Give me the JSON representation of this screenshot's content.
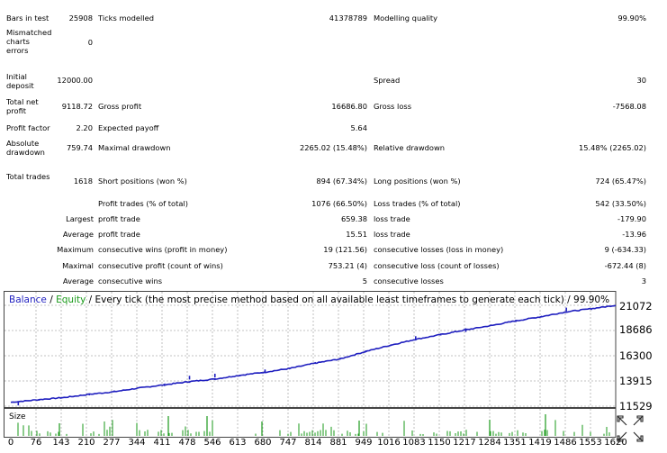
{
  "rows": [
    {
      "top": 15,
      "label": "Bars in test",
      "v1": "25908",
      "lab1": "Ticks modelled",
      "v2": "41378789",
      "lab2": "Modelling quality",
      "v3": "99.90%"
    },
    {
      "top": 31,
      "label": "Mismatched charts errors",
      "v1": "0",
      "v1top": 42
    },
    {
      "top": 80,
      "label": "Initial deposit",
      "v1": "12000.00",
      "v1top": 84,
      "lab2": "Spread",
      "v3": "30"
    },
    {
      "top": 108,
      "label": "Total net profit",
      "v1": "9118.72",
      "lab1": "Gross profit",
      "v2": "16686.80",
      "lab2": "Gross loss",
      "v3": "-7568.08",
      "vtop": 113
    },
    {
      "top": 137,
      "label": "Profit factor",
      "v1": "2.20",
      "lab1": "Expected payoff",
      "v2": "5.64"
    },
    {
      "top": 154,
      "label": "Absolute drawdown",
      "v1": "759.74",
      "lab1": "Maximal drawdown",
      "v2": "2265.02 (15.48%)",
      "lab2": "Relative drawdown",
      "v3": "15.48% (2265.02)",
      "vtop": 159
    },
    {
      "top": 191,
      "label": "Total trades",
      "v1": "1618",
      "lab1": "Short positions (won %)",
      "v2": "894 (67.34%)",
      "lab2": "Long positions (won %)",
      "v3": "724 (65.47%)",
      "vtop": 196
    },
    {
      "top": 221,
      "lab1": "Profit trades (% of total)",
      "v2": "1076 (66.50%)",
      "lab2": "Loss trades (% of total)",
      "v3": "542 (33.50%)"
    },
    {
      "top": 238,
      "ind": "Largest",
      "lab1": "profit trade",
      "v2": "659.38",
      "lab2": "loss trade",
      "v3": "-179.90"
    },
    {
      "top": 255,
      "ind": "Average",
      "lab1": "profit trade",
      "v2": "15.51",
      "lab2": "loss trade",
      "v3": "-13.96"
    },
    {
      "top": 272,
      "ind": "Maximum",
      "lab1": "consecutive wins (profit in money)",
      "v2": "19 (121.56)",
      "lab2": "consecutive losses (loss in money)",
      "v3": "9 (-634.33)"
    },
    {
      "top": 290,
      "ind": "Maximal",
      "lab1": "consecutive profit (count of wins)",
      "v2": "753.21 (4)",
      "lab2": "consecutive loss (count of losses)",
      "v3": "-672.44 (8)"
    },
    {
      "top": 307,
      "ind": "Average",
      "lab1": "consecutive wins",
      "v2": "5",
      "lab2": "consecutive losses",
      "v3": "3"
    }
  ],
  "chart": {
    "legend_balance": "Balance",
    "legend_sep1": " / ",
    "legend_equity": "Equity",
    "legend_rest": " / Every tick (the most precise method based on all available least timeframes to generate each tick) / 99.90%",
    "size_label": "Size",
    "colors": {
      "balance": "#1f1fbf",
      "equity": "#1a9a1a",
      "grid": "#b0b0b0"
    },
    "y_labels": [
      "21072",
      "18686",
      "16300",
      "13915",
      "11529"
    ],
    "x_labels": [
      "0",
      "76",
      "143",
      "210",
      "277",
      "344",
      "411",
      "478",
      "546",
      "613",
      "680",
      "747",
      "814",
      "881",
      "949",
      "1016",
      "1083",
      "1150",
      "1217",
      "1284",
      "1351",
      "1419",
      "1486",
      "1553",
      "1620"
    ],
    "chart_data": {
      "type": "line",
      "x_range": [
        0,
        1618
      ],
      "y_range": [
        11529,
        21072
      ],
      "series": [
        {
          "name": "Balance",
          "x": [
            0,
            76,
            143,
            210,
            277,
            344,
            411,
            478,
            546,
            613,
            680,
            747,
            814,
            881,
            949,
            1016,
            1083,
            1150,
            1217,
            1284,
            1351,
            1419,
            1486,
            1553,
            1618
          ],
          "y": [
            11900,
            12150,
            12350,
            12650,
            12900,
            13250,
            13550,
            13850,
            14100,
            14450,
            14750,
            15100,
            15600,
            16000,
            16700,
            17300,
            17850,
            18300,
            18750,
            19150,
            19600,
            20000,
            20450,
            20750,
            21072
          ]
        }
      ]
    }
  }
}
